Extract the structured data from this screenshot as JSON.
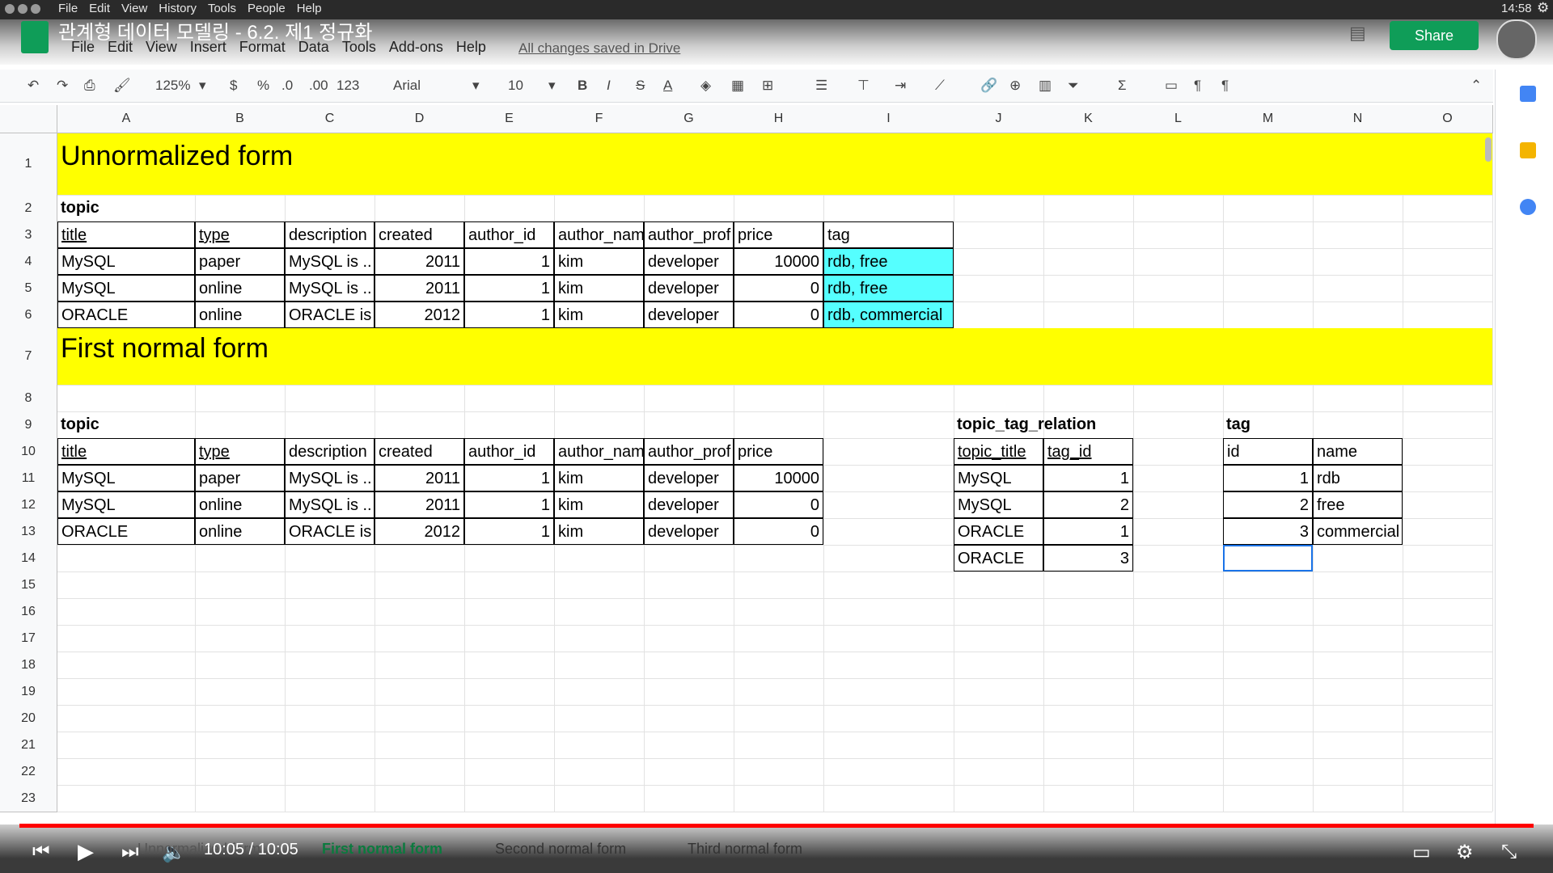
{
  "os": {
    "menu": [
      "File",
      "Edit",
      "View",
      "History",
      "Tools",
      "People",
      "Help"
    ],
    "clock": "14:58"
  },
  "doc": {
    "title": "관계형 데이터 모델링 - 6.2. 제1 정규화",
    "menus": [
      "File",
      "Edit",
      "View",
      "Insert",
      "Format",
      "Data",
      "Tools",
      "Add-ons",
      "Help"
    ],
    "saved_text": "All changes saved in Drive",
    "share_label": "Share"
  },
  "toolbar": {
    "zoom": "125%",
    "currency": "$",
    "percent": "%",
    "dec_decrease": ".0",
    "dec_increase": ".00",
    "format_more": "123",
    "font": "Arial",
    "font_size": "10",
    "bold": "B",
    "italic": "I",
    "strike": "S",
    "text_color": "A"
  },
  "columns": [
    "A",
    "B",
    "C",
    "D",
    "E",
    "F",
    "G",
    "H",
    "I",
    "J",
    "K",
    "L",
    "M",
    "N",
    "O"
  ],
  "rows": [
    "1",
    "2",
    "3",
    "4",
    "5",
    "6",
    "7",
    "8",
    "9",
    "10",
    "11",
    "12",
    "13",
    "14",
    "15",
    "16",
    "17",
    "18",
    "19",
    "20",
    "21",
    "22",
    "23"
  ],
  "sheet": {
    "unnormalized_title": "Unnormalized form",
    "topic_label": "topic",
    "headers_unnorm": [
      "title",
      "type",
      "description",
      "created",
      "author_id",
      "author_nam",
      "author_prof",
      "price",
      "tag"
    ],
    "rows_unnorm": [
      [
        "MySQL",
        "paper",
        "MySQL is ..",
        "2011",
        "1",
        "kim",
        "developer",
        "10000",
        "rdb, free"
      ],
      [
        "MySQL",
        "online",
        "MySQL is ..",
        "2011",
        "1",
        "kim",
        "developer",
        "0",
        "rdb, free"
      ],
      [
        "ORACLE",
        "online",
        "ORACLE is",
        "2012",
        "1",
        "kim",
        "developer",
        "0",
        "rdb, commercial"
      ]
    ],
    "first_normal_title": "First normal form",
    "topic_label_2": "topic",
    "headers_1nf": [
      "title",
      "type",
      "description",
      "created",
      "author_id",
      "author_nam",
      "author_prof",
      "price"
    ],
    "rows_1nf": [
      [
        "MySQL",
        "paper",
        "MySQL is ..",
        "2011",
        "1",
        "kim",
        "developer",
        "10000"
      ],
      [
        "MySQL",
        "online",
        "MySQL is ..",
        "2011",
        "1",
        "kim",
        "developer",
        "0"
      ],
      [
        "ORACLE",
        "online",
        "ORACLE is",
        "2012",
        "1",
        "kim",
        "developer",
        "0"
      ]
    ],
    "relation_label": "topic_tag_relation",
    "relation_headers": [
      "topic_title",
      "tag_id"
    ],
    "relation_rows": [
      [
        "MySQL",
        "1"
      ],
      [
        "MySQL",
        "2"
      ],
      [
        "ORACLE",
        "1"
      ],
      [
        "ORACLE",
        "3"
      ]
    ],
    "tag_label": "tag",
    "tag_headers": [
      "id",
      "name"
    ],
    "tag_rows": [
      [
        "1",
        "rdb"
      ],
      [
        "2",
        "free"
      ],
      [
        "3",
        "commercial"
      ]
    ]
  },
  "player": {
    "time": "10:05 / 10:05",
    "tabs": [
      "Unnormalized form",
      "First normal form",
      "Second normal form",
      "Third normal form"
    ]
  },
  "colors": {
    "highlight_yellow": "#ffff00",
    "highlight_cyan": "#55ffff",
    "progress": "#ff0000"
  }
}
